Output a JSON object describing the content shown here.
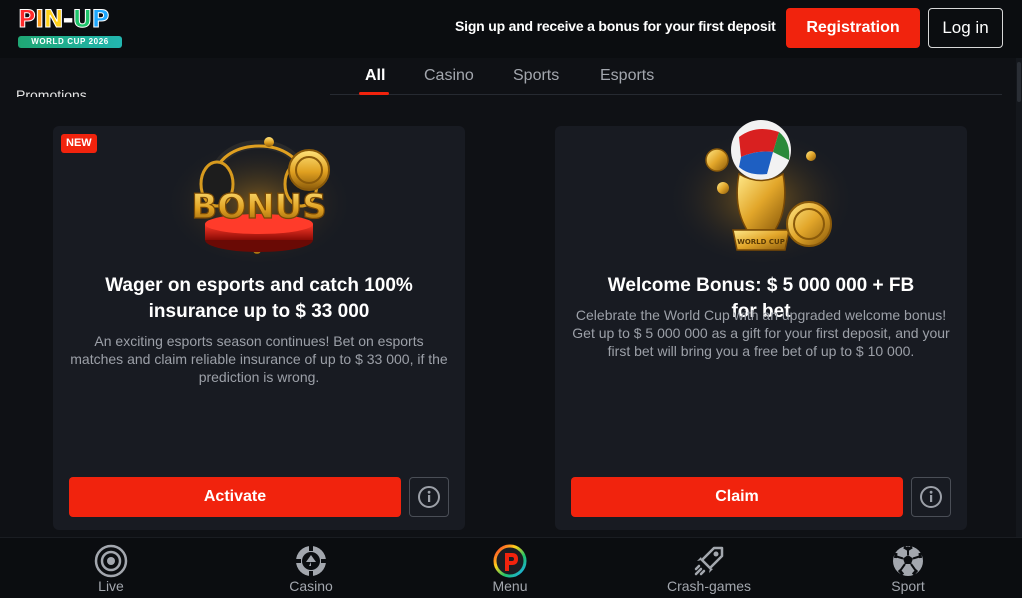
{
  "header": {
    "logo_text": [
      "P",
      "I",
      "N",
      "-",
      "U",
      "P"
    ],
    "logo_colors": [
      "#ff2a2a",
      "#ff9f1a",
      "#ffd21a",
      "#ffffff",
      "#1ec46a",
      "#1ea7ff"
    ],
    "logo_subtitle": "WORLD CUP 2026",
    "promo_text": "Sign up and receive a bonus for your first deposit",
    "registration_label": "Registration",
    "login_label": "Log in"
  },
  "tabs": [
    {
      "label": "All",
      "active": true
    },
    {
      "label": "Casino",
      "active": false
    },
    {
      "label": "Sports",
      "active": false
    },
    {
      "label": "Esports",
      "active": false
    }
  ],
  "section_label": "Promotions",
  "cards": [
    {
      "badge": "NEW",
      "art_text": "BONUS",
      "title": "Wager on esports and catch 100% insurance up to $ 33 000",
      "description": "An exciting esports season continues! Bet on esports matches and claim reliable insurance of up to $ 33 000, if the prediction is wrong.",
      "button_label": "Activate"
    },
    {
      "art_text": "WORLD CUP",
      "title": "Welcome Bonus: $ 5 000 000 + FB for bet",
      "description": "Celebrate the World Cup with an upgraded welcome bonus! Get up to $ 5 000 000 as a gift for your first deposit, and your first bet will bring you a free bet of up to $ 10 000.",
      "button_label": "Claim"
    }
  ],
  "bottom_nav": [
    {
      "label": "Live",
      "icon": "live-icon"
    },
    {
      "label": "Casino",
      "icon": "casino-chip-icon"
    },
    {
      "label": "Menu",
      "icon": "pinup-logo-icon"
    },
    {
      "label": "Crash-games",
      "icon": "rocket-icon"
    },
    {
      "label": "Sport",
      "icon": "soccer-ball-icon"
    }
  ],
  "colors": {
    "accent": "#f1230d",
    "background": "#0f1115",
    "card": "#181b22",
    "muted_text": "#9ca0a8"
  }
}
